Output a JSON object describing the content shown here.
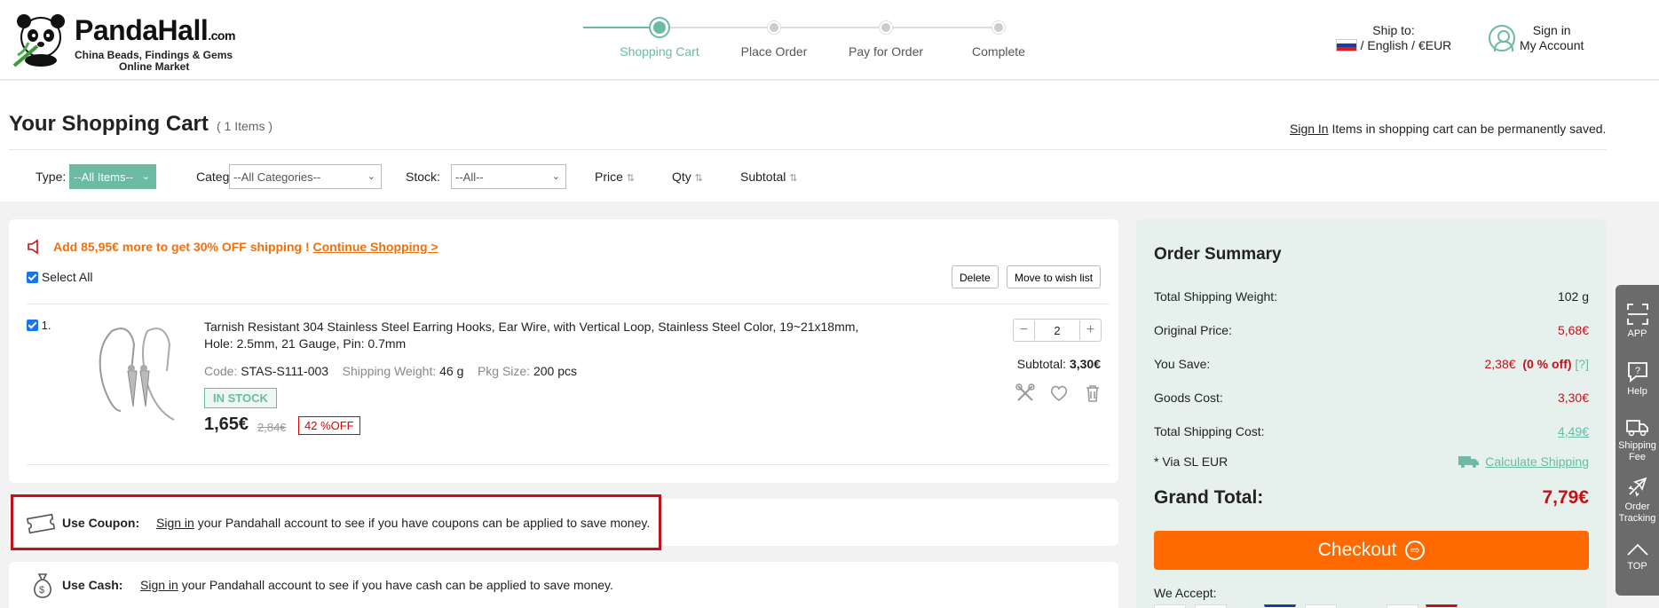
{
  "header": {
    "logo_main": "PandaHall",
    "logo_suffix": ".com",
    "logo_tagline1": "China Beads, Findings & Gems",
    "logo_tagline2": "Online Market",
    "steps": [
      {
        "label": "Shopping Cart",
        "active": true
      },
      {
        "label": "Place Order",
        "active": false
      },
      {
        "label": "Pay for Order",
        "active": false
      },
      {
        "label": "Complete",
        "active": false
      }
    ],
    "ship_to_label": "Ship to:",
    "ship_to_value": "/ English / €EUR",
    "sign_in": "Sign in",
    "my_account": "My Account"
  },
  "cart": {
    "title": "Your Shopping Cart",
    "count": "( 1  Items )",
    "sign_in_link": "Sign In",
    "saved_msg": " Items in shopping cart can be permanently saved.",
    "filters": {
      "type_label": "Type:",
      "type_value": "--All Items--",
      "category_label": "Category:",
      "category_value": "--All Categories--",
      "stock_label": "Stock:",
      "stock_value": "--All--",
      "sort_price": "Price",
      "sort_qty": "Qty",
      "sort_subtotal": "Subtotal"
    },
    "promo_text": "Add 85,95€ more to get 30% OFF shipping ! ",
    "promo_link": "Continue Shopping >",
    "select_all": "Select All",
    "delete_btn": "Delete",
    "wishlist_btn": "Move to wish list",
    "item": {
      "index": "1.",
      "title": "Tarnish Resistant 304 Stainless Steel Earring Hooks, Ear Wire, with Vertical Loop, Stainless Steel Color, 19~21x18mm, Hole: 2.5mm, 21 Gauge, Pin: 0.7mm",
      "code_label": "Code:",
      "code": "STAS-S111-003",
      "weight_label": "Shipping Weight:",
      "weight": "46 g",
      "pkg_label": "Pkg Size:",
      "pkg": "200 pcs",
      "stock": "IN STOCK",
      "price": "1,65€",
      "old_price": "2,84€",
      "discount": "42 %OFF",
      "qty": "2",
      "subtotal_label": "Subtotal:",
      "subtotal": "3,30€"
    },
    "coupon": {
      "label": "Use Coupon:",
      "link": "Sign in",
      "text": " your Pandahall account to see if you have coupons can be applied to save money."
    },
    "cash": {
      "label": "Use Cash:",
      "link": "Sign in",
      "text": " your Pandahall account to see if you have cash can be applied to save money."
    }
  },
  "summary": {
    "title": "Order Summary",
    "weight_label": "Total Shipping Weight:",
    "weight_value": "102  g",
    "orig_label": "Original Price:",
    "orig_value": "5,68€",
    "save_label": "You Save:",
    "save_value": "2,38€",
    "save_pct": "(0 % off)",
    "save_help": "[?]",
    "goods_label": "Goods Cost:",
    "goods_value": "3,30€",
    "ship_label": "Total Shipping Cost:",
    "ship_value": "4,49€",
    "via_label": "* Via SL EUR",
    "calc_link": "Calculate Shipping",
    "grand_label": "Grand Total:",
    "grand_value": "7,79€",
    "checkout": "Checkout",
    "accept": "We Accept:"
  },
  "sidebar": {
    "app": "APP",
    "help": "Help",
    "shipping1": "Shipping",
    "shipping2": "Fee",
    "order1": "Order",
    "order2": "Tracking",
    "top": "TOP"
  },
  "colors": {
    "brand_teal": "#6abaa4",
    "checkout_orange": "#ff6a00",
    "price_red": "#c1121c",
    "promo_orange": "#f07010"
  }
}
